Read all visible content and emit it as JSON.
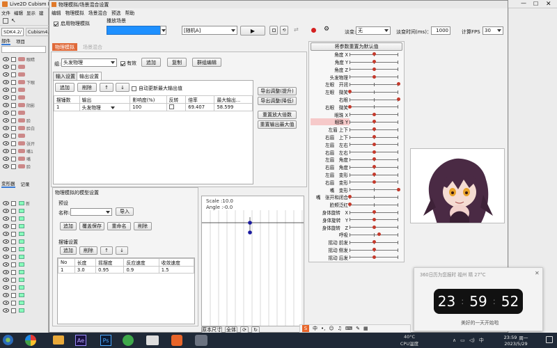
{
  "dialog": {
    "title": "物理模拟/场景混合设置",
    "menu": [
      "编辑",
      "物理模拟",
      "场景混合",
      "预选",
      "帮助"
    ]
  },
  "top": {
    "enable_physics": "启用物理模拟",
    "scene_label": "播放场景",
    "random_value": "[随机A]",
    "wind_label": "淡变:",
    "wind_value": "无",
    "fade_time_label": "淡变时间(ms)：",
    "fade_time_value": "1000",
    "fps_label": "计算FPS",
    "fps_value": "30"
  },
  "tabs": {
    "physics": "物理模拟",
    "scene": "场景混合"
  },
  "group": {
    "label": "组:",
    "value": "头发物理",
    "valid_label": "有效",
    "add": "追加",
    "copy": "复制",
    "group_edit": "群组编辑"
  },
  "subtabs": {
    "input": "输入设置",
    "output": "输出设置"
  },
  "output_toolbar": {
    "add": "追加",
    "delete": "削除",
    "up": "↑",
    "down": "↓",
    "auto_update": "自动更新最大输出值"
  },
  "output_table": {
    "headers": [
      "摆锤数",
      "输出",
      "影响度(%)",
      "反转",
      "倍率",
      "最大输出..."
    ],
    "rows": [
      [
        "1",
        "头发物理",
        "100",
        "",
        "69.407",
        "58.599"
      ]
    ]
  },
  "right_buttons": {
    "adjust_up": "导出调整(提升)",
    "adjust_down": "导出调整(降低)",
    "reset_scale": "重置放大倍数",
    "reset_max": "重置输出最大值"
  },
  "model_panel": {
    "title": "物理模拟的模型设置",
    "preset_label": "预设",
    "name_label": "名称:",
    "import": "导入",
    "add": "追加",
    "overwrite": "覆盖保存",
    "rename": "重命名",
    "delete": "削除",
    "pendulum_label": "摆锤设置",
    "p_add": "追加",
    "p_delete": "削除",
    "p_up": "↑",
    "p_down": "↓",
    "table_headers": [
      "No",
      "长度",
      "摇摆度",
      "反应速度",
      "收敛速度"
    ],
    "table_rows": [
      [
        "1",
        "3.0",
        "0.95",
        "0.9",
        "1.5"
      ]
    ]
  },
  "preview": {
    "scale": "Scale :10.0",
    "angle": "Angle :-0.0",
    "real_size": "原本尺寸",
    "whole": "全体"
  },
  "params": {
    "reset_button": "将参数重置为默认值",
    "items": [
      {
        "label": "角度 X",
        "pos": 0.5,
        "hl": false
      },
      {
        "label": "角度 Y",
        "pos": 0.5,
        "hl": false
      },
      {
        "label": "角度 Z",
        "pos": 0.5,
        "hl": false
      },
      {
        "label": "头发物理",
        "pos": 0.5,
        "hl": false
      },
      {
        "label": "左眼　开闭",
        "pos": 1.0,
        "hl": false
      },
      {
        "label": "左眼　微笑",
        "pos": 0.0,
        "hl": false
      },
      {
        "label": "右眼",
        "pos": 1.0,
        "hl": false
      },
      {
        "label": "右眼　微笑",
        "pos": 0.0,
        "hl": false
      },
      {
        "label": "眼珠 X",
        "pos": 0.5,
        "hl": false
      },
      {
        "label": "眼珠 Y",
        "pos": 0.5,
        "hl": true
      },
      {
        "label": "左眉 上下",
        "pos": 0.5,
        "hl": false
      },
      {
        "label": "右眉　上下",
        "pos": 0.5,
        "hl": false
      },
      {
        "label": "左眉　左右",
        "pos": 0.5,
        "hl": false
      },
      {
        "label": "右眉　左右",
        "pos": 0.5,
        "hl": false
      },
      {
        "label": "左眉　角度",
        "pos": 0.5,
        "hl": false
      },
      {
        "label": "右眉　角度",
        "pos": 0.5,
        "hl": false
      },
      {
        "label": "左眉　变形",
        "pos": 0.5,
        "hl": false
      },
      {
        "label": "右眉　变形",
        "pos": 0.5,
        "hl": false
      },
      {
        "label": "嘴　变形",
        "pos": 1.0,
        "hl": false
      },
      {
        "label": "嘴　张开和闭合",
        "pos": 0.0,
        "hl": false
      },
      {
        "label": "脸颊泛红",
        "pos": 0.0,
        "hl": false
      },
      {
        "label": "身体旋转　X",
        "pos": 0.5,
        "hl": false
      },
      {
        "label": "身体旋转　Y",
        "pos": 0.5,
        "hl": false
      },
      {
        "label": "身体旋转　Z",
        "pos": 0.5,
        "hl": false
      },
      {
        "label": "呼吸",
        "pos": 0.6,
        "hl": false
      },
      {
        "label": "摇动 前发",
        "pos": 0.5,
        "hl": false
      },
      {
        "label": "摇动 侧发",
        "pos": 0.5,
        "hl": false
      },
      {
        "label": "摇动 后发",
        "pos": 0.5,
        "hl": false
      }
    ]
  },
  "left_app": {
    "title": "Live2D Cubism Ed",
    "menu": [
      "文件",
      "编辑",
      "显示",
      "建"
    ],
    "doc_tabs": [
      "SDK4.2/",
      "Cubism4.2"
    ],
    "panel_tabs": [
      "部件",
      "项目"
    ],
    "bottom_tabs": [
      "变形器",
      "记录"
    ],
    "layers": [
      "眼睛",
      "",
      "",
      "下眼",
      "",
      "",
      "阴影",
      "",
      "脸",
      "脸白",
      "",
      "张开",
      "嘴1",
      "嘴",
      "脸"
    ],
    "defs": [
      "新",
      "",
      "",
      "",
      "",
      "",
      "",
      "",
      "",
      "",
      "",
      "",
      "",
      "",
      ""
    ]
  },
  "clock": {
    "header": "360日历为您报时 福州 晴 27°C",
    "h": "23",
    "m": "59",
    "s": "52",
    "greeting": "美好的一天开始啦"
  },
  "taskbar": {
    "temp": "40°C",
    "temp_label": "CPU温度",
    "time": "23:59",
    "day_label": "周一",
    "date": "2023/5/29"
  },
  "colors": {
    "accent": "#1e90ff",
    "tab_active": "#e06a3a",
    "title_bar": "#e8e8e8",
    "knob": "#c43a2c"
  }
}
